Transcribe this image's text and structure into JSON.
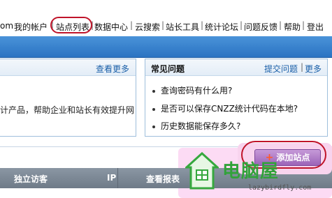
{
  "topnav": {
    "domain_tail": "om",
    "items": [
      "我的帐户",
      "站点列表",
      "数据中心",
      "云搜索",
      "站长工具",
      "统计论坛",
      "问题反馈",
      "帮助",
      "登出"
    ]
  },
  "left_panel": {
    "more_link": "查看更多",
    "text": "计产品，帮助企业和站长有效提升网"
  },
  "faq_panel": {
    "title": "常见问题",
    "submit_link": "提交问题",
    "more_link": "更多",
    "items": [
      "查询密码有什么用?",
      "是否可以保存CNZZ统计代码在本地?",
      "历史数据能保存多久?"
    ]
  },
  "add_site_button": {
    "label": "添加站点",
    "icon": "plus-icon"
  },
  "table_header": {
    "col1": "独立访客",
    "col2": "IP",
    "col3": "查看报表"
  },
  "watermark": {
    "logo_text": "电脑屋",
    "url": "lazybirdfly.com"
  }
}
